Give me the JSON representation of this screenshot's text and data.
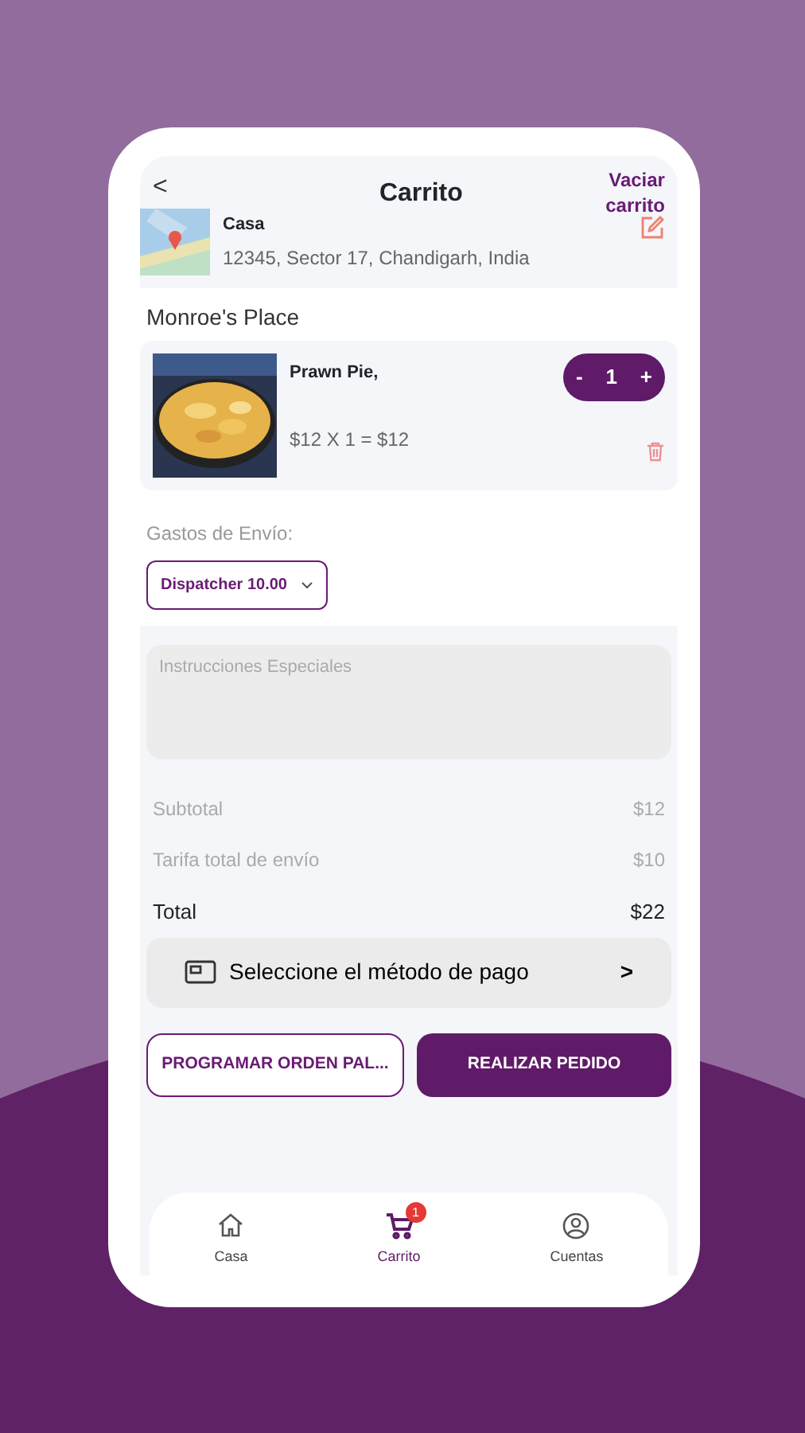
{
  "header": {
    "back": "<",
    "title": "Carrito",
    "clear_action": "Vaciar carrito"
  },
  "address": {
    "label": "Casa",
    "line": "12345,  Sector 17, Chandigarh, India"
  },
  "restaurant": "Monroe's Place",
  "items": [
    {
      "name": "Prawn Pie,",
      "price_line": "$12 X 1 = $12",
      "minus": "-",
      "quantity": "1",
      "plus": "+"
    }
  ],
  "shipping": {
    "label": "Gastos de Envío:",
    "selection": "Dispatcher  10.00"
  },
  "instructions": {
    "placeholder": "Instrucciones Especiales"
  },
  "summary": [
    {
      "label": "Subtotal",
      "value": "$12",
      "kind": "muted"
    },
    {
      "label": "Tarifa total de envío",
      "value": "$10",
      "kind": "muted"
    },
    {
      "label": "Total",
      "value": "$22",
      "kind": "total"
    }
  ],
  "payment": {
    "label": "Seleccione el método de pago",
    "chevron": ">"
  },
  "buttons": [
    {
      "label": "PROGRAMAR ORDEN PAL...",
      "kind": "outline"
    },
    {
      "label": "REALIZAR PEDIDO",
      "kind": "filled"
    }
  ],
  "nav": [
    {
      "label": "Casa",
      "selected": false
    },
    {
      "label": "Carrito",
      "selected": true,
      "badge": "1"
    },
    {
      "label": "Cuentas",
      "selected": false
    }
  ]
}
